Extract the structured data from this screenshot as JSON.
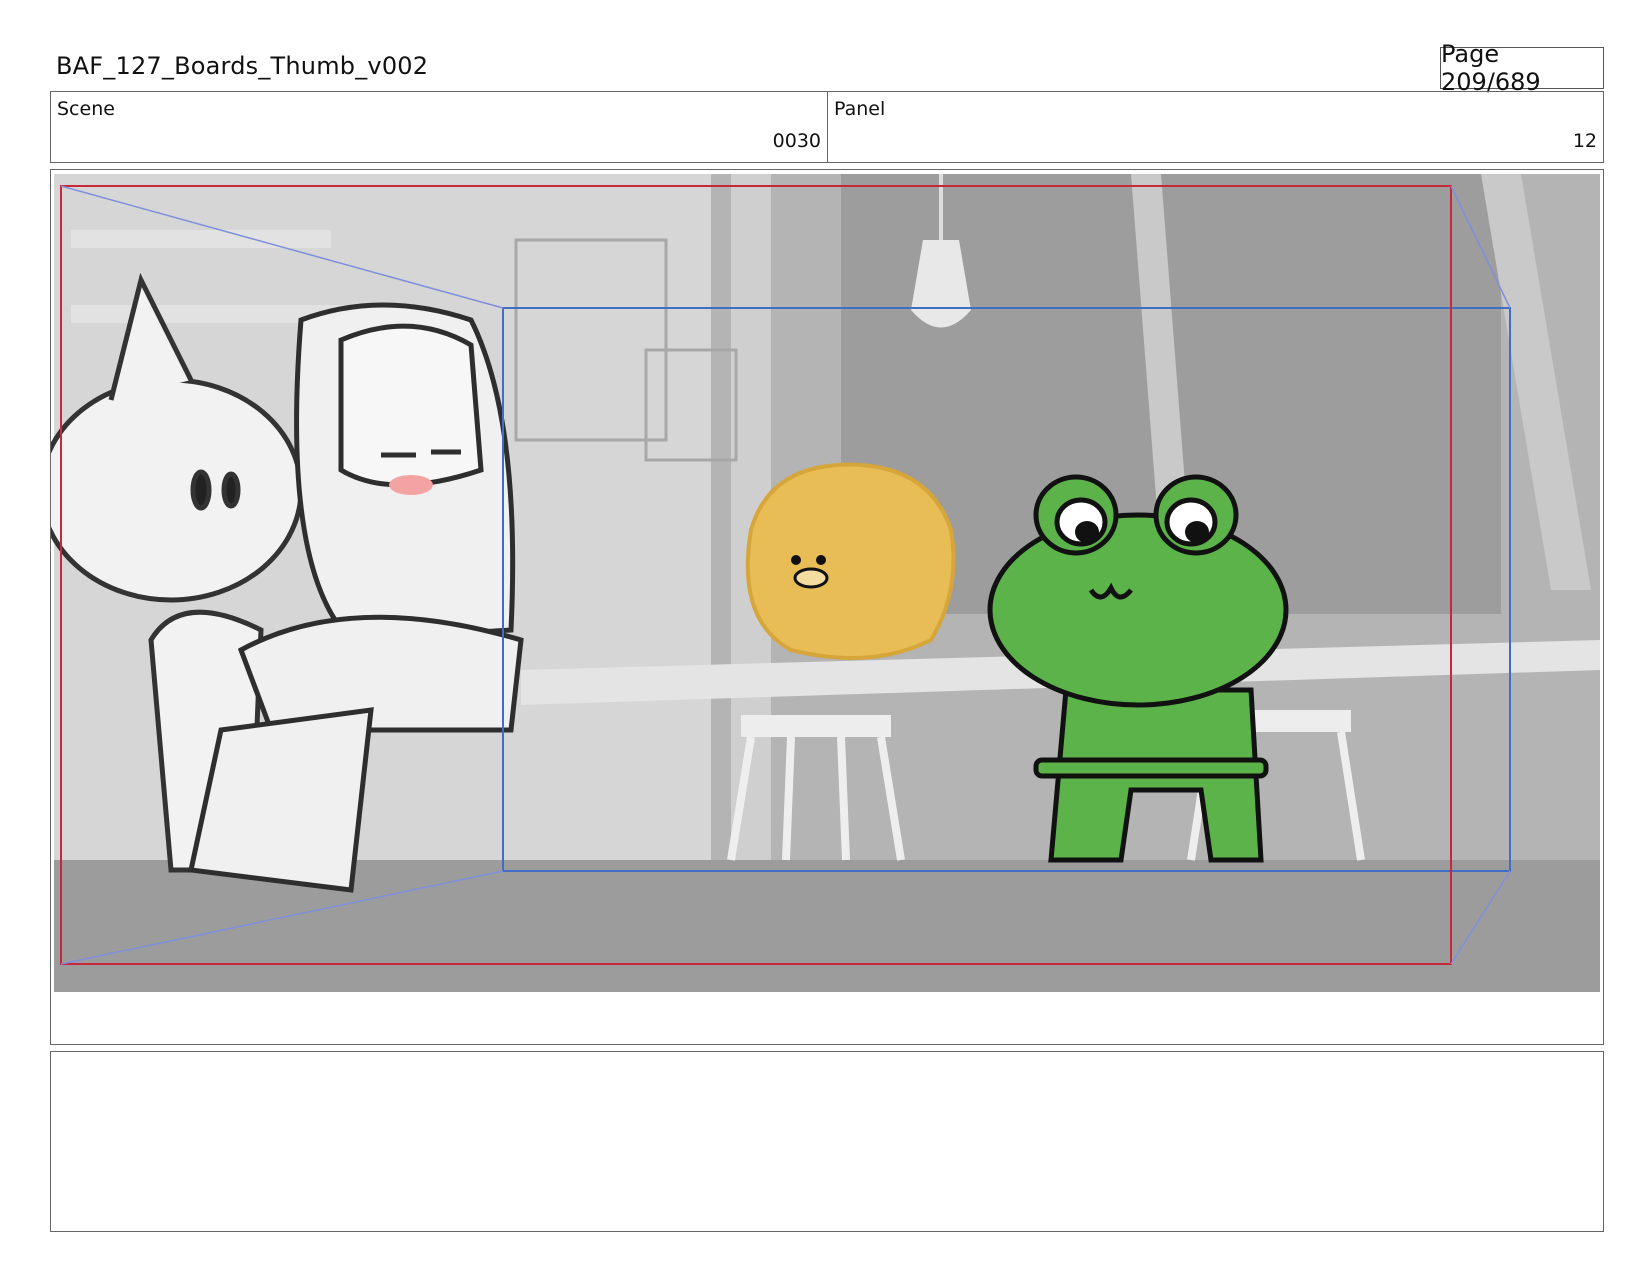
{
  "header": {
    "title": "BAF_127_Boards_Thumb_v002",
    "page": "Page 209/689"
  },
  "scene": {
    "label": "Scene",
    "value": "0030"
  },
  "panel": {
    "label": "Panel",
    "value": "12"
  },
  "colors": {
    "safe_frame": "#c8283a",
    "camera_frame": "#3f6ec4",
    "frog_green": "#5bb34a",
    "duck_yellow": "#e8bd55",
    "background_gray": "#b9b9b9"
  },
  "notes": ""
}
